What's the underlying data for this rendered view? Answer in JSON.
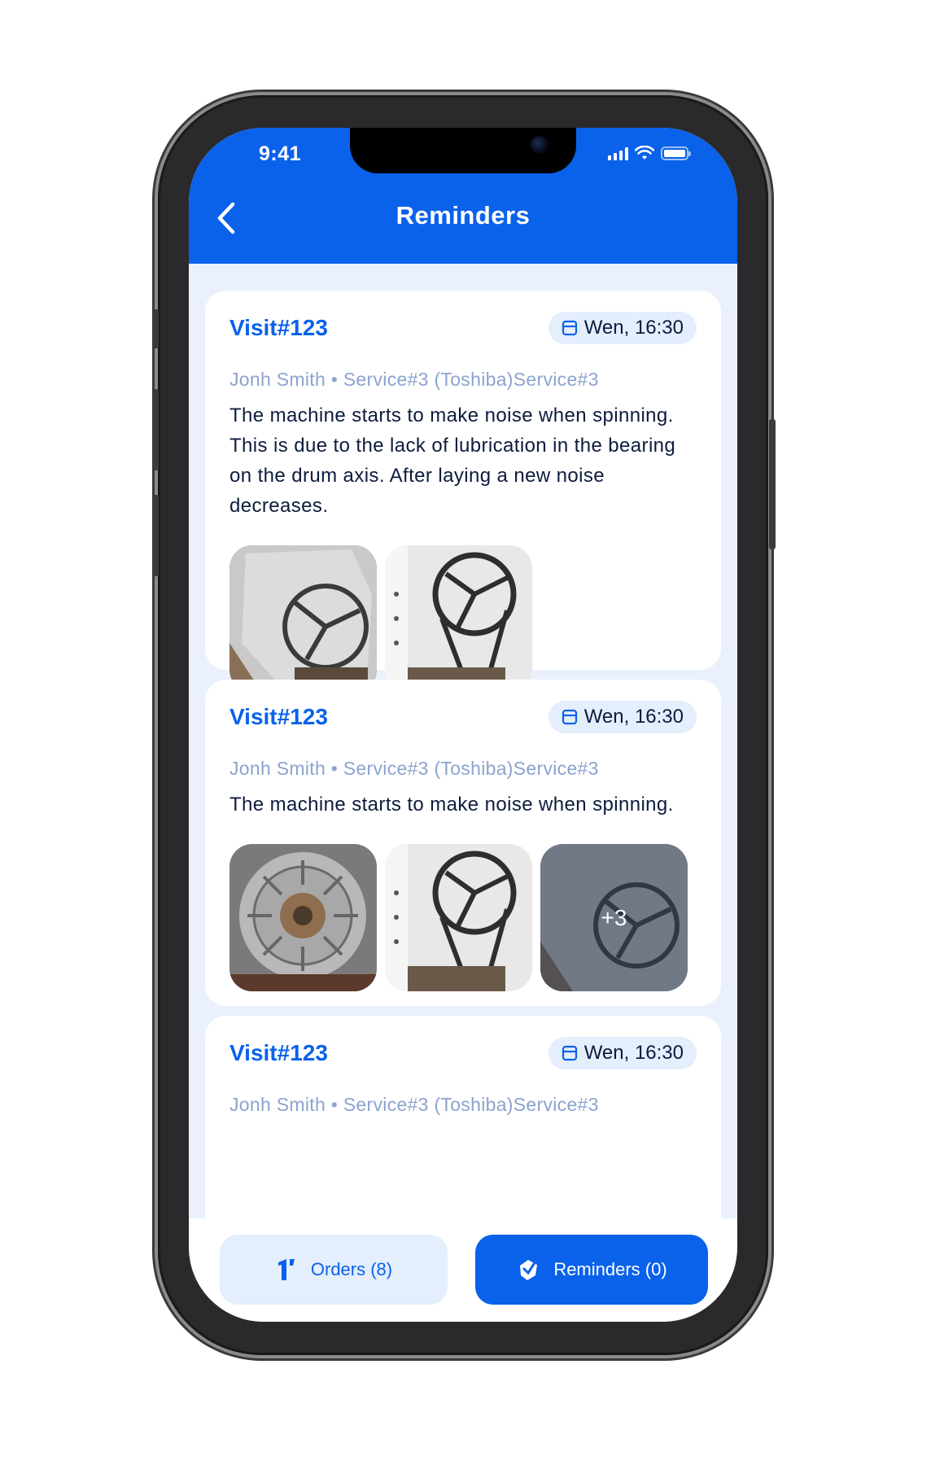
{
  "status_bar": {
    "time": "9:41"
  },
  "header": {
    "title": "Reminders",
    "back_icon": "chevron-left-icon"
  },
  "colors": {
    "primary": "#0a62ea",
    "background": "#eaf1fd",
    "meta_text": "#8ca3cf",
    "body_text": "#0d1b3e"
  },
  "cards": [
    {
      "visit": "Visit#123",
      "date": "Wen, 16:30",
      "meta": "Jonh Smith • Service#3 (Toshiba)Service#3",
      "description": "The machine starts to make noise when spinning. This is due to the lack of lubrication in the bearing on the drum axis. After laying a new noise decreases.",
      "photos": [
        "drum-photo",
        "belt-photo"
      ]
    },
    {
      "visit": "Visit#123",
      "date": "Wen, 16:30",
      "meta": "Jonh Smith • Service#3 (Toshiba)Service#3",
      "description": "The machine starts to make noise when spinning.",
      "photos": [
        "bearing-photo",
        "belt-photo",
        "drum-photo"
      ],
      "more_count": "+3"
    },
    {
      "visit": "Visit#123",
      "date": "Wen, 16:30",
      "meta": "Jonh Smith • Service#3 (Toshiba)Service#3"
    }
  ],
  "tabs": {
    "orders": {
      "label": "Orders (8)",
      "icon": "orders-icon"
    },
    "reminders": {
      "label": "Reminders (0)",
      "icon": "reminders-icon"
    }
  }
}
